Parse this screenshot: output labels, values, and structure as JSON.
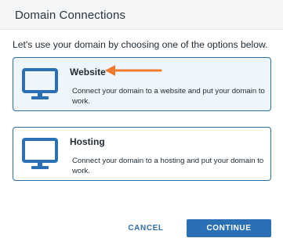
{
  "dialog": {
    "title": "Domain Connections",
    "intro": "Let's use your domain by choosing one of the options below."
  },
  "options": [
    {
      "name": "Website",
      "description": "Connect your domain to a website and put your domain to work.",
      "icon": "monitor-icon",
      "selected": true
    },
    {
      "name": "Hosting",
      "description": "Connect your domain to a hosting and put your domain to work.",
      "icon": "monitor-icon",
      "selected": false
    }
  ],
  "footer": {
    "cancel_label": "CANCEL",
    "continue_label": "CONTINUE"
  },
  "colors": {
    "accent": "#2b6fb5",
    "border": "#2b6fa8",
    "selected_bg": "#eef5fb",
    "annotation_arrow": "#f07a2a"
  }
}
